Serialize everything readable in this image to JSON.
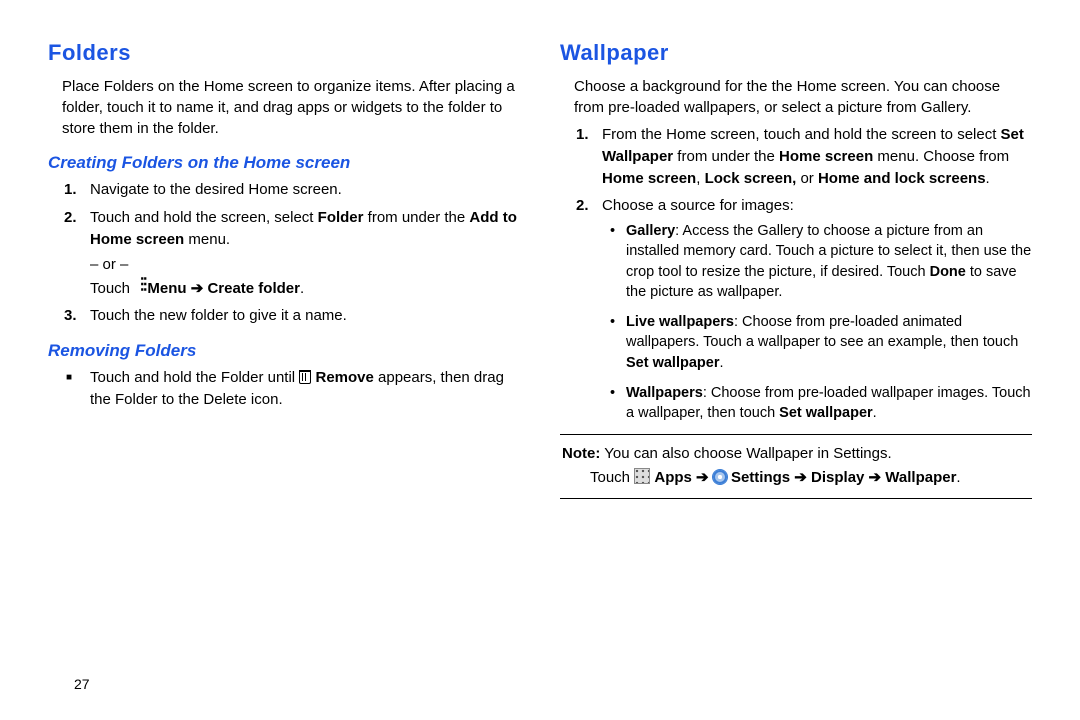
{
  "page_number": "27",
  "left": {
    "heading": "Folders",
    "intro": "Place Folders on the Home screen to organize items. After placing a folder, touch it to name it, and drag apps or widgets to the folder to store them in the folder.",
    "sub1": "Creating Folders on the Home screen",
    "steps": {
      "s1": "Navigate to the desired Home screen.",
      "s2a": "Touch and hold the screen, select ",
      "s2b_bold": "Folder",
      "s2c": " from under the ",
      "s2d_bold": "Add to Home screen",
      "s2e": " menu.",
      "or": "– or –",
      "touch_pre": "Touch ",
      "touch_bold": "Menu ➔ Create folder",
      "touch_post": ".",
      "s3": "Touch the new folder to give it a name."
    },
    "sub2": "Removing Folders",
    "remove": {
      "a": "Touch and hold the Folder until ",
      "b_bold": "Remove",
      "c": " appears, then drag the Folder to the Delete icon."
    }
  },
  "right": {
    "heading": "Wallpaper",
    "intro": "Choose a background for the the Home screen. You can choose from pre-loaded wallpapers, or select a picture from Gallery.",
    "s1": {
      "a": "From the Home screen, touch and hold the screen to select ",
      "b_bold": "Set Wallpaper",
      "c": " from under the ",
      "d_bold": "Home screen",
      "e": " menu. Choose from ",
      "f_bold": "Home screen",
      "g": ", ",
      "h_bold": "Lock screen,",
      "i": " or ",
      "j_bold": "Home and lock screens",
      "k": "."
    },
    "s2_intro": "Choose a source for images:",
    "bullets": {
      "gal_bold": "Gallery",
      "gal": ": Access the Gallery to choose a picture from an installed memory card. Touch a picture to select it, then use the crop tool to resize the picture, if desired. Touch ",
      "gal_done_bold": "Done",
      "gal_end": " to save the picture as wallpaper.",
      "live_bold": "Live wallpapers",
      "live": ": Choose from pre-loaded animated wallpapers. Touch a wallpaper to see an example, then touch ",
      "live_set_bold": "Set wallpaper",
      "live_end": ".",
      "wp_bold": "Wallpapers",
      "wp": ": Choose from pre-loaded wallpaper images. Touch a wallpaper, then touch ",
      "wp_set_bold": "Set wallpaper",
      "wp_end": "."
    },
    "note": {
      "label_bold": "Note:",
      "text": " You can also choose Wallpaper in Settings.",
      "path_pre": "Touch ",
      "apps_bold": "Apps ➔ ",
      "settings_bold": "Settings ➔ Display  ➔ Wallpaper",
      "path_post": "."
    }
  }
}
